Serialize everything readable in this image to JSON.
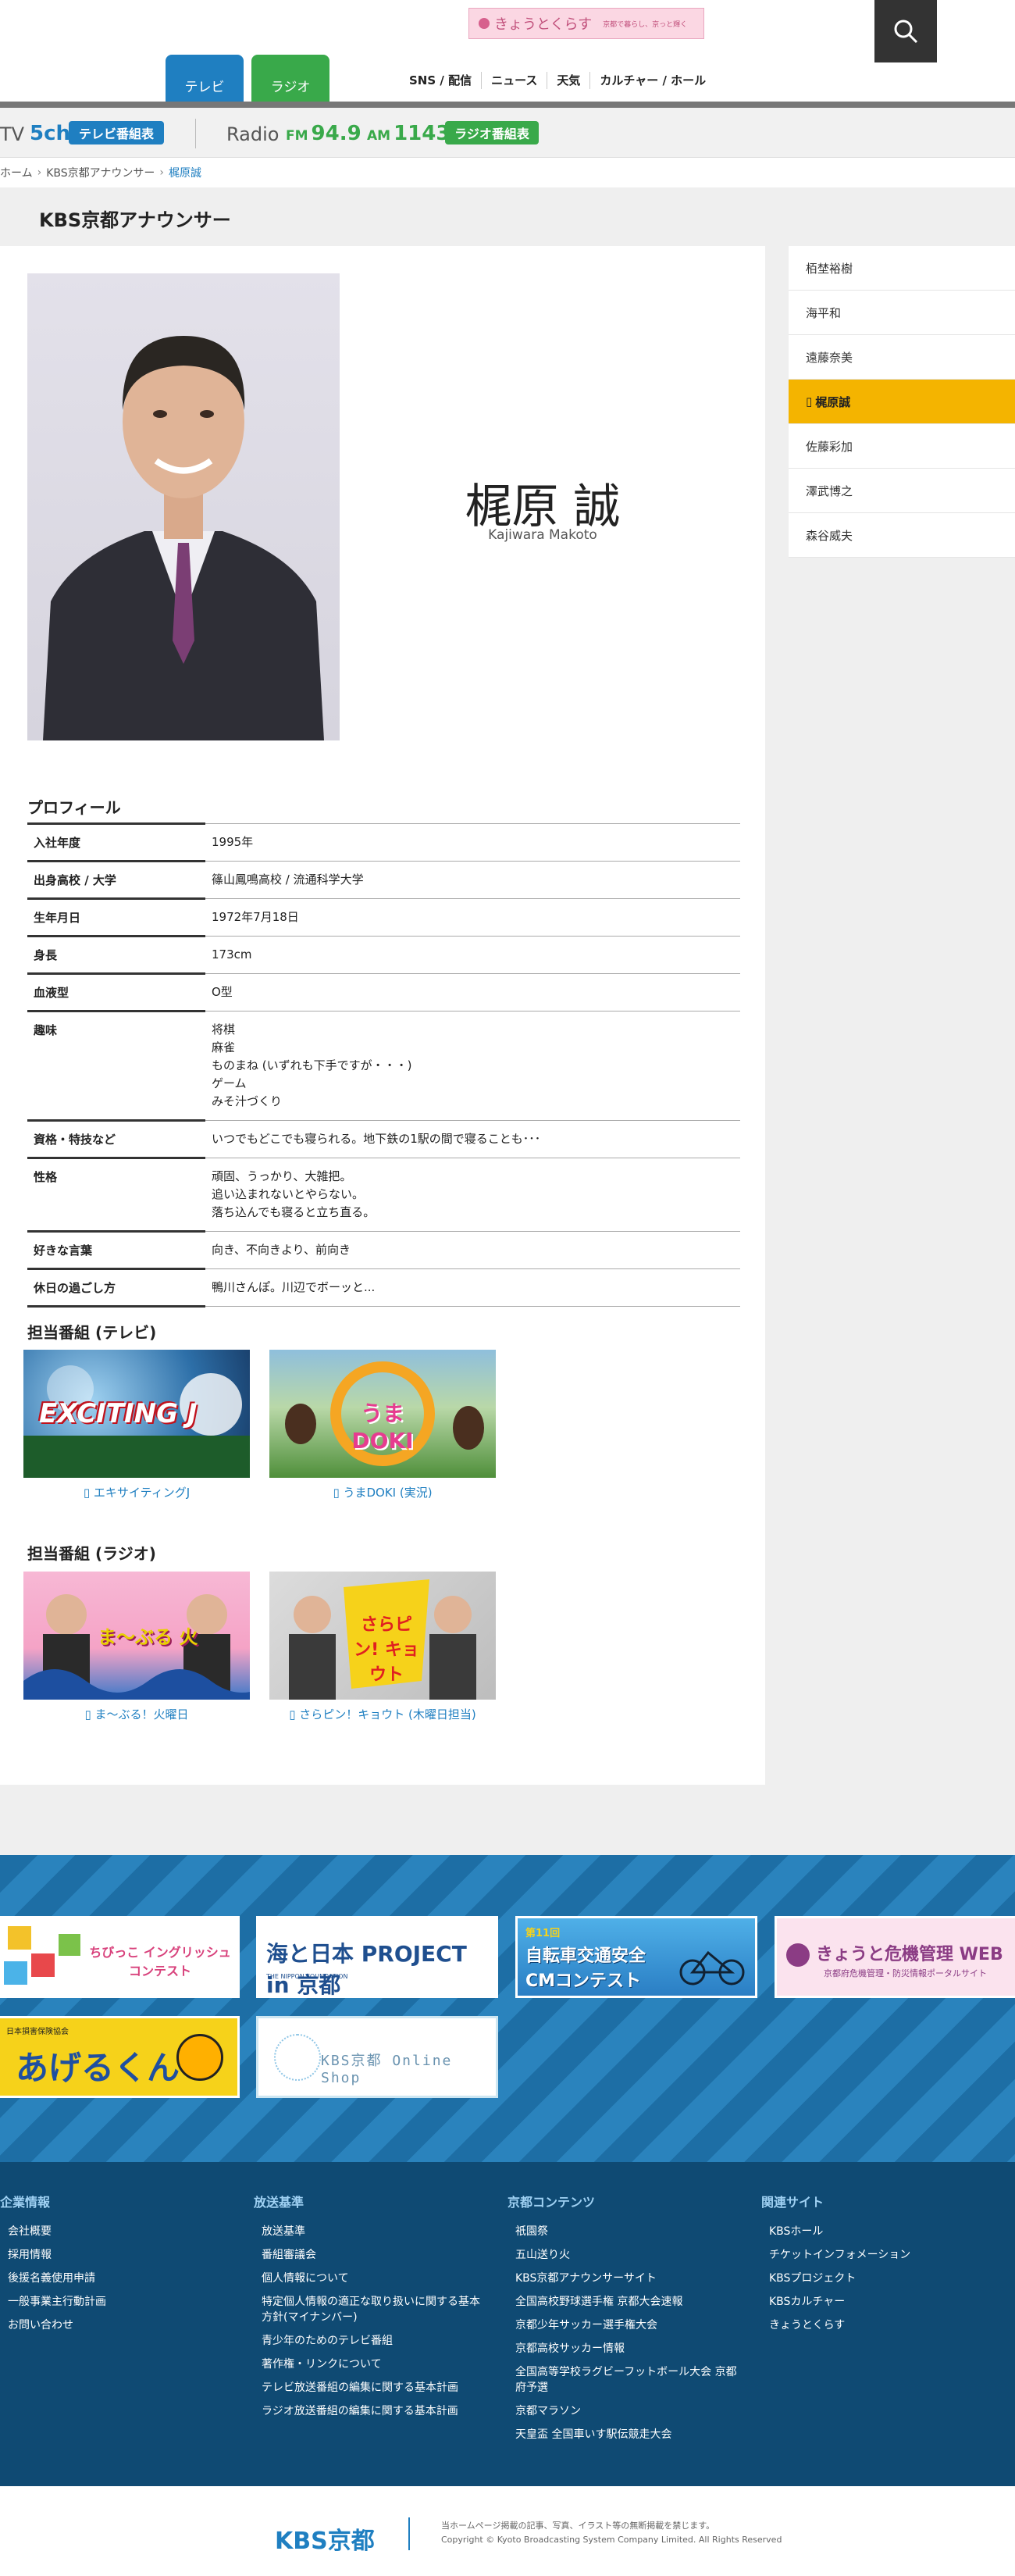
{
  "header": {
    "banner_text": "きょうとくらす",
    "banner_sub": "京都で暮らし、京っと輝く",
    "tabs": [
      "テレビ",
      "ラジオ"
    ],
    "gnav": [
      "SNS / 配信",
      "ニュース",
      "天気",
      "カルチャー / ホール"
    ]
  },
  "station_bar": {
    "tv_label": "TV",
    "tv_channel": "5ch",
    "tv_guide": "テレビ番組表",
    "radio_label": "Radio",
    "fm_prefix": "FM",
    "fm_value": "94.9",
    "am_prefix": "AM",
    "am_value": "1143",
    "radio_guide": "ラジオ番組表"
  },
  "breadcrumb": {
    "home": "ホーム",
    "parent": "KBS京都アナウンサー",
    "current": "梶原誠"
  },
  "page_title": "KBS京都アナウンサー",
  "announcer": {
    "name_ja": "梶原 誠",
    "name_en": "Kajiwara Makoto"
  },
  "profile": {
    "title": "プロフィール",
    "rows": [
      {
        "label": "入社年度",
        "value": "1995年"
      },
      {
        "label": "出身高校 / 大学",
        "value": "篠山鳳鳴高校 / 流通科学大学"
      },
      {
        "label": "生年月日",
        "value": "1972年7月18日"
      },
      {
        "label": "身長",
        "value": "173cm"
      },
      {
        "label": "血液型",
        "value": "O型"
      },
      {
        "label": "趣味",
        "value": "将棋\n麻雀\nものまね (いずれも下手ですが・・・)\nゲーム\nみそ汁づくり"
      },
      {
        "label": "資格・特技など",
        "value": "いつでもどこでも寝られる。地下鉄の1駅の間で寝ることも･･･"
      },
      {
        "label": "性格",
        "value": "頑固、うっかり、大雑把。\n追い込まれないとやらない。\n落ち込んでも寝ると立ち直る。"
      },
      {
        "label": "好きな言葉",
        "value": "向き、不向きより、前向き"
      },
      {
        "label": "休日の過ごし方",
        "value": "鴨川さんぽ。川辺でボーッと..."
      }
    ]
  },
  "programs_tv": {
    "title": "担当番組 (テレビ)",
    "items": [
      {
        "caption": "エキサイティングJ",
        "thumb_text": "EXCITING J"
      },
      {
        "caption": "うまDOKI (実況)",
        "thumb_text": "うま DOKI"
      }
    ]
  },
  "programs_radio": {
    "title": "担当番組 (ラジオ)",
    "items": [
      {
        "caption": "ま～ぶる！火曜日",
        "thumb_text": "ま～ぶる 火"
      },
      {
        "caption": "さらピン！キョウト (木曜日担当)",
        "thumb_text": "さらピン! キョウト"
      }
    ]
  },
  "sidenav": [
    {
      "label": "栢埜裕樹"
    },
    {
      "label": "海平和"
    },
    {
      "label": "遠藤奈美"
    },
    {
      "label": "梶原誠"
    },
    {
      "label": "佐藤彩加"
    },
    {
      "label": "澤武博之"
    },
    {
      "label": "森谷威夫"
    }
  ],
  "banners": [
    {
      "title": "ちびっこ イングリッシュコンテスト"
    },
    {
      "title": "海と日本 PROJECT in 京都",
      "sub": "THE NIPPON FOUNDATION"
    },
    {
      "title": "自転車交通安全 CMコンテスト",
      "sub": "第11回"
    },
    {
      "title": "きょうと危機管理 WEB",
      "sub": "京都府危機管理・防災情報ポータルサイト"
    },
    {
      "title": "あげるくん",
      "sub": "日本損害保険協会"
    },
    {
      "title": "KBS京都 Online Shop"
    }
  ],
  "footer": {
    "cols": [
      {
        "title": "企業情報",
        "items": [
          "会社概要",
          "採用情報",
          "後援名義使用申請",
          "一般事業主行動計画",
          "お問い合わせ"
        ]
      },
      {
        "title": "放送基準",
        "items": [
          "放送基準",
          "番組審議会",
          "個人情報について",
          "特定個人情報の適正な取り扱いに関する基本方針(マイナンバー)",
          "青少年のためのテレビ番組",
          "著作権・リンクについて",
          "テレビ放送番組の編集に関する基本計画",
          "ラジオ放送番組の編集に関する基本計画"
        ]
      },
      {
        "title": "京都コンテンツ",
        "items": [
          "祇園祭",
          "五山送り火",
          "KBS京都アナウンサーサイト",
          "全国高校野球選手権 京都大会速報",
          "京都少年サッカー選手権大会",
          "京都高校サッカー情報",
          "全国高等学校ラグビーフットボール大会 京都府予選",
          "京都マラソン",
          "天皇盃 全国車いす駅伝競走大会"
        ]
      },
      {
        "title": "関連サイト",
        "items": [
          "KBSホール",
          "チケットインフォメーション",
          "KBSプロジェクト",
          "KBSカルチャー",
          "きょうとくらす"
        ]
      }
    ],
    "logo": "KBS京都",
    "notice": "当ホームページ掲載の記事、写真、イラスト等の無断掲載を禁じます。",
    "copyright": "Copyright © Kyoto Broadcasting System Company Limited. All Rights Reserved"
  },
  "colors": {
    "tv": "#1f7fc1",
    "radio": "#39a94a",
    "active": "#f4b400",
    "footer": "#0f4a73"
  }
}
